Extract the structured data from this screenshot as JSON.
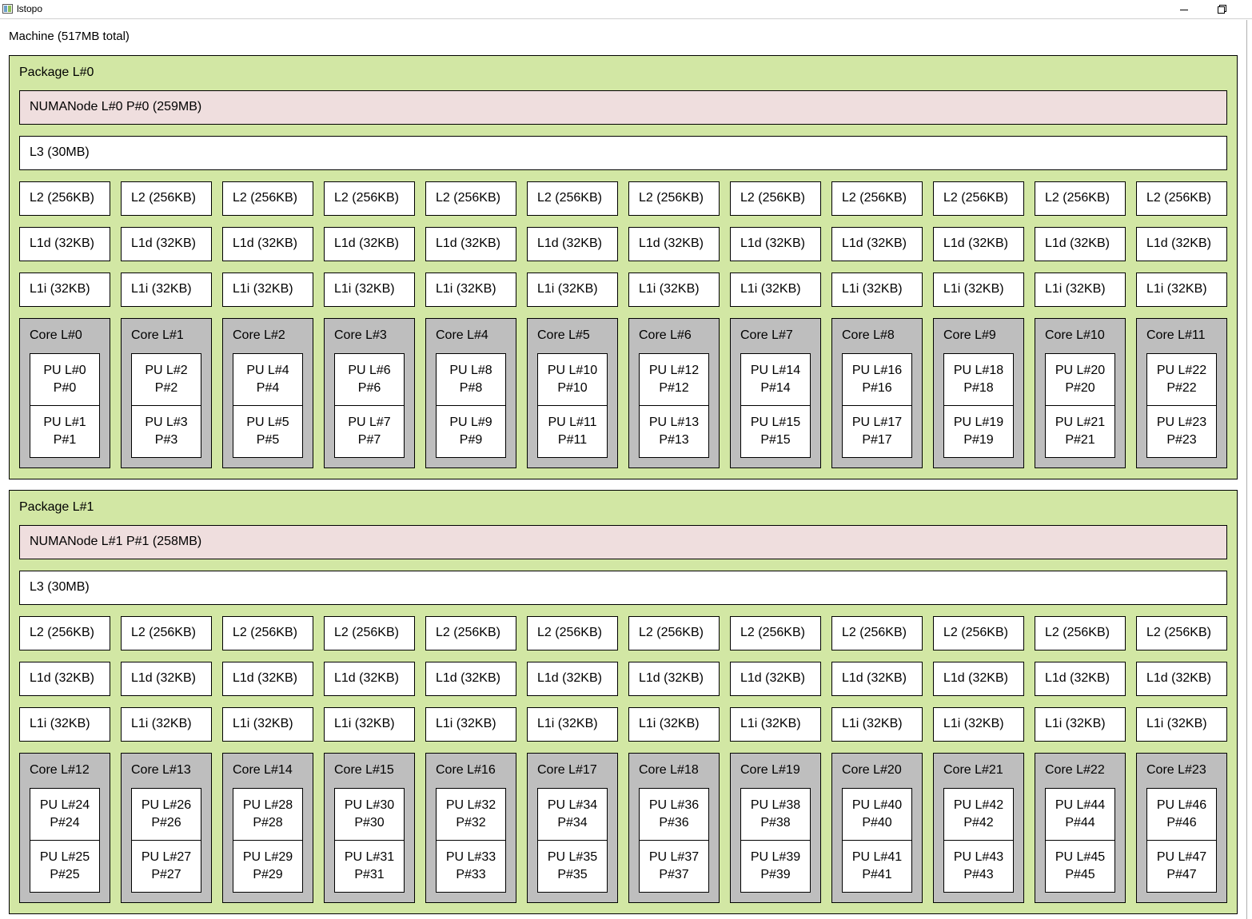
{
  "window": {
    "title": "lstopo",
    "minimize_label": "",
    "restore_label": ""
  },
  "machine": {
    "label": "Machine (517MB total)"
  },
  "packages": [
    {
      "label": "Package L#0",
      "numa": "NUMANode L#0 P#0 (259MB)",
      "l3": "L3 (30MB)",
      "l2": [
        "L2 (256KB)",
        "L2 (256KB)",
        "L2 (256KB)",
        "L2 (256KB)",
        "L2 (256KB)",
        "L2 (256KB)",
        "L2 (256KB)",
        "L2 (256KB)",
        "L2 (256KB)",
        "L2 (256KB)",
        "L2 (256KB)",
        "L2 (256KB)"
      ],
      "l1d": [
        "L1d (32KB)",
        "L1d (32KB)",
        "L1d (32KB)",
        "L1d (32KB)",
        "L1d (32KB)",
        "L1d (32KB)",
        "L1d (32KB)",
        "L1d (32KB)",
        "L1d (32KB)",
        "L1d (32KB)",
        "L1d (32KB)",
        "L1d (32KB)"
      ],
      "l1i": [
        "L1i (32KB)",
        "L1i (32KB)",
        "L1i (32KB)",
        "L1i (32KB)",
        "L1i (32KB)",
        "L1i (32KB)",
        "L1i (32KB)",
        "L1i (32KB)",
        "L1i (32KB)",
        "L1i (32KB)",
        "L1i (32KB)",
        "L1i (32KB)"
      ],
      "cores": [
        {
          "label": "Core L#0",
          "pus": [
            {
              "l": "PU L#0",
              "p": "P#0"
            },
            {
              "l": "PU L#1",
              "p": "P#1"
            }
          ]
        },
        {
          "label": "Core L#1",
          "pus": [
            {
              "l": "PU L#2",
              "p": "P#2"
            },
            {
              "l": "PU L#3",
              "p": "P#3"
            }
          ]
        },
        {
          "label": "Core L#2",
          "pus": [
            {
              "l": "PU L#4",
              "p": "P#4"
            },
            {
              "l": "PU L#5",
              "p": "P#5"
            }
          ]
        },
        {
          "label": "Core L#3",
          "pus": [
            {
              "l": "PU L#6",
              "p": "P#6"
            },
            {
              "l": "PU L#7",
              "p": "P#7"
            }
          ]
        },
        {
          "label": "Core L#4",
          "pus": [
            {
              "l": "PU L#8",
              "p": "P#8"
            },
            {
              "l": "PU L#9",
              "p": "P#9"
            }
          ]
        },
        {
          "label": "Core L#5",
          "pus": [
            {
              "l": "PU L#10",
              "p": "P#10"
            },
            {
              "l": "PU L#11",
              "p": "P#11"
            }
          ]
        },
        {
          "label": "Core L#6",
          "pus": [
            {
              "l": "PU L#12",
              "p": "P#12"
            },
            {
              "l": "PU L#13",
              "p": "P#13"
            }
          ]
        },
        {
          "label": "Core L#7",
          "pus": [
            {
              "l": "PU L#14",
              "p": "P#14"
            },
            {
              "l": "PU L#15",
              "p": "P#15"
            }
          ]
        },
        {
          "label": "Core L#8",
          "pus": [
            {
              "l": "PU L#16",
              "p": "P#16"
            },
            {
              "l": "PU L#17",
              "p": "P#17"
            }
          ]
        },
        {
          "label": "Core L#9",
          "pus": [
            {
              "l": "PU L#18",
              "p": "P#18"
            },
            {
              "l": "PU L#19",
              "p": "P#19"
            }
          ]
        },
        {
          "label": "Core L#10",
          "pus": [
            {
              "l": "PU L#20",
              "p": "P#20"
            },
            {
              "l": "PU L#21",
              "p": "P#21"
            }
          ]
        },
        {
          "label": "Core L#11",
          "pus": [
            {
              "l": "PU L#22",
              "p": "P#22"
            },
            {
              "l": "PU L#23",
              "p": "P#23"
            }
          ]
        }
      ]
    },
    {
      "label": "Package L#1",
      "numa": "NUMANode L#1 P#1 (258MB)",
      "l3": "L3 (30MB)",
      "l2": [
        "L2 (256KB)",
        "L2 (256KB)",
        "L2 (256KB)",
        "L2 (256KB)",
        "L2 (256KB)",
        "L2 (256KB)",
        "L2 (256KB)",
        "L2 (256KB)",
        "L2 (256KB)",
        "L2 (256KB)",
        "L2 (256KB)",
        "L2 (256KB)"
      ],
      "l1d": [
        "L1d (32KB)",
        "L1d (32KB)",
        "L1d (32KB)",
        "L1d (32KB)",
        "L1d (32KB)",
        "L1d (32KB)",
        "L1d (32KB)",
        "L1d (32KB)",
        "L1d (32KB)",
        "L1d (32KB)",
        "L1d (32KB)",
        "L1d (32KB)"
      ],
      "l1i": [
        "L1i (32KB)",
        "L1i (32KB)",
        "L1i (32KB)",
        "L1i (32KB)",
        "L1i (32KB)",
        "L1i (32KB)",
        "L1i (32KB)",
        "L1i (32KB)",
        "L1i (32KB)",
        "L1i (32KB)",
        "L1i (32KB)",
        "L1i (32KB)"
      ],
      "cores": [
        {
          "label": "Core L#12",
          "pus": [
            {
              "l": "PU L#24",
              "p": "P#24"
            },
            {
              "l": "PU L#25",
              "p": "P#25"
            }
          ]
        },
        {
          "label": "Core L#13",
          "pus": [
            {
              "l": "PU L#26",
              "p": "P#26"
            },
            {
              "l": "PU L#27",
              "p": "P#27"
            }
          ]
        },
        {
          "label": "Core L#14",
          "pus": [
            {
              "l": "PU L#28",
              "p": "P#28"
            },
            {
              "l": "PU L#29",
              "p": "P#29"
            }
          ]
        },
        {
          "label": "Core L#15",
          "pus": [
            {
              "l": "PU L#30",
              "p": "P#30"
            },
            {
              "l": "PU L#31",
              "p": "P#31"
            }
          ]
        },
        {
          "label": "Core L#16",
          "pus": [
            {
              "l": "PU L#32",
              "p": "P#32"
            },
            {
              "l": "PU L#33",
              "p": "P#33"
            }
          ]
        },
        {
          "label": "Core L#17",
          "pus": [
            {
              "l": "PU L#34",
              "p": "P#34"
            },
            {
              "l": "PU L#35",
              "p": "P#35"
            }
          ]
        },
        {
          "label": "Core L#18",
          "pus": [
            {
              "l": "PU L#36",
              "p": "P#36"
            },
            {
              "l": "PU L#37",
              "p": "P#37"
            }
          ]
        },
        {
          "label": "Core L#19",
          "pus": [
            {
              "l": "PU L#38",
              "p": "P#38"
            },
            {
              "l": "PU L#39",
              "p": "P#39"
            }
          ]
        },
        {
          "label": "Core L#20",
          "pus": [
            {
              "l": "PU L#40",
              "p": "P#40"
            },
            {
              "l": "PU L#41",
              "p": "P#41"
            }
          ]
        },
        {
          "label": "Core L#21",
          "pus": [
            {
              "l": "PU L#42",
              "p": "P#42"
            },
            {
              "l": "PU L#43",
              "p": "P#43"
            }
          ]
        },
        {
          "label": "Core L#22",
          "pus": [
            {
              "l": "PU L#44",
              "p": "P#44"
            },
            {
              "l": "PU L#45",
              "p": "P#45"
            }
          ]
        },
        {
          "label": "Core L#23",
          "pus": [
            {
              "l": "PU L#46",
              "p": "P#46"
            },
            {
              "l": "PU L#47",
              "p": "P#47"
            }
          ]
        }
      ]
    }
  ]
}
